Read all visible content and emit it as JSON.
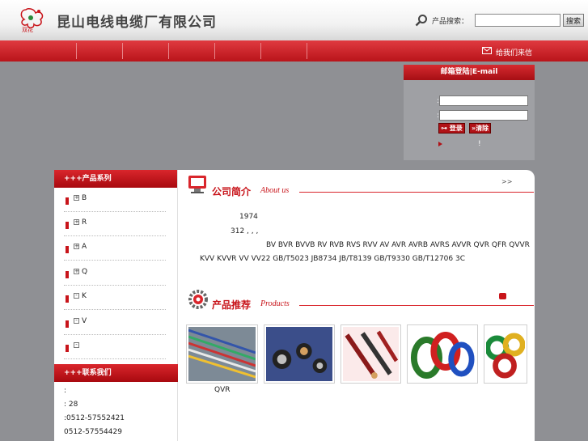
{
  "header": {
    "company_name": "昆山电线电缆厂有限公司",
    "logo_text": "双花",
    "search_label": "产品搜索：",
    "search_value": "",
    "search_button": "搜索"
  },
  "nav": {
    "mail_label": "给我们来信"
  },
  "login": {
    "title": "邮箱登陆|E-mail",
    "colon1": ":",
    "colon2": ":",
    "login_button": "登录",
    "clear_button": "»清除",
    "note": "!"
  },
  "sidebar": {
    "products_title": "+++产品系列",
    "categories": [
      {
        "box": "+",
        "label": "B"
      },
      {
        "box": "+",
        "label": "R"
      },
      {
        "box": "+",
        "label": "A"
      },
      {
        "box": "+",
        "label": "Q"
      },
      {
        "box": "-",
        "label": "K"
      },
      {
        "box": "-",
        "label": "V"
      },
      {
        "box": "-",
        "label": ""
      }
    ],
    "contact_title": "+++联系我们",
    "contact_lines": [
      ":",
      ":       28",
      ":0512-57552421",
      "0512-57554429"
    ]
  },
  "about": {
    "title_cn": "公司简介",
    "title_en": "About us",
    "more": ">>",
    "lines": [
      "1974",
      "312 ,        ,      ,",
      "BV BVR BVVB RV RVB RVS RVV AV AVR AVRB AVRS AVVR QVR QFR QVVR",
      "KVV KVVR VV VV22                    GB/T5023 JB8734 JB/T8139 GB/T9330 GB/T12706          3C"
    ]
  },
  "products": {
    "title_cn": "产品推荐",
    "title_en": "Products",
    "first_caption": "QVR",
    "thumbs": [
      "wire-strands",
      "power-cable-cross-section",
      "cable-cutaways",
      "wire-coils",
      "colored-wire-spools"
    ]
  },
  "colors": {
    "brand_red": "#c8141a",
    "panel_gray": "#8f9094"
  }
}
